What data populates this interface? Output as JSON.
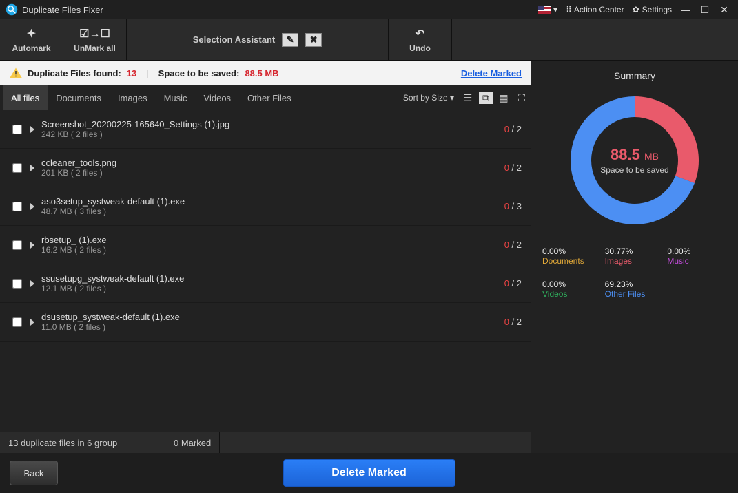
{
  "title": "Duplicate Files Fixer",
  "titlebar": {
    "action_center": "Action Center",
    "settings": "Settings"
  },
  "toolbar": {
    "automark": "Automark",
    "unmark_all": "UnMark all",
    "selection_assistant": "Selection Assistant",
    "undo": "Undo"
  },
  "infobar": {
    "found_label": "Duplicate Files found:",
    "found_count": "13",
    "space_label": "Space to be saved:",
    "space_value": "88.5 MB",
    "delete_marked": "Delete Marked"
  },
  "tabs": [
    "All files",
    "Documents",
    "Images",
    "Music",
    "Videos",
    "Other Files"
  ],
  "sort_label": "Sort by Size",
  "groups": [
    {
      "name": "Screenshot_20200225-165640_Settings (1).jpg",
      "size": "242 KB",
      "count": 2,
      "selected": 0
    },
    {
      "name": "ccleaner_tools.png",
      "size": "201 KB",
      "count": 2,
      "selected": 0
    },
    {
      "name": "aso3setup_systweak-default (1).exe",
      "size": "48.7 MB",
      "count": 3,
      "selected": 0
    },
    {
      "name": "rbsetup_ (1).exe",
      "size": "16.2 MB",
      "count": 2,
      "selected": 0
    },
    {
      "name": "ssusetupg_systweak-default (1).exe",
      "size": "12.1 MB",
      "count": 2,
      "selected": 0
    },
    {
      "name": "dsusetup_systweak-default (1).exe",
      "size": "11.0 MB",
      "count": 2,
      "selected": 0
    }
  ],
  "status": {
    "left": "13 duplicate files in 6 group",
    "marked": "0 Marked"
  },
  "footer": {
    "back": "Back",
    "delete_marked": "Delete Marked"
  },
  "summary": {
    "title": "Summary",
    "center_value": "88.5",
    "center_unit": "MB",
    "center_label": "Space to be saved",
    "categories": [
      {
        "pct": "0.00%",
        "label": "Documents",
        "class": "c-doc"
      },
      {
        "pct": "30.77%",
        "label": "Images",
        "class": "c-img"
      },
      {
        "pct": "0.00%",
        "label": "Music",
        "class": "c-mus"
      },
      {
        "pct": "0.00%",
        "label": "Videos",
        "class": "c-vid"
      },
      {
        "pct": "69.23%",
        "label": "Other Files",
        "class": "c-oth"
      }
    ]
  },
  "chart_data": {
    "type": "pie",
    "title": "Space to be saved breakdown",
    "unit": "%",
    "series": [
      {
        "name": "Documents",
        "value": 0.0,
        "color": "#e0a838"
      },
      {
        "name": "Images",
        "value": 30.77,
        "color": "#e95a6b"
      },
      {
        "name": "Music",
        "value": 0.0,
        "color": "#c04bd8"
      },
      {
        "name": "Videos",
        "value": 0.0,
        "color": "#2fae5c"
      },
      {
        "name": "Other Files",
        "value": 69.23,
        "color": "#4c8ff3"
      }
    ],
    "total_label": "88.5 MB"
  }
}
